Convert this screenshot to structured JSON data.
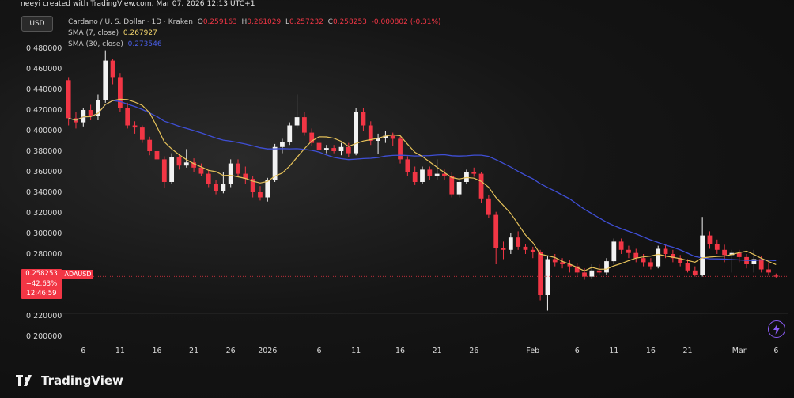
{
  "header": {
    "created_line": "neeyi created with TradingView.com, Mar 07, 2026 12:13 UTC+1",
    "currency": "USD",
    "symbol_line": "Cardano / U. S. Dollar · 1D · Kraken",
    "ohlc": {
      "O": "0.259163",
      "H": "0.261029",
      "L": "0.257232",
      "C": "0.258253",
      "change": "-0.000802 (-0.31%)"
    },
    "sma7_label": "SMA (7, close)",
    "sma7_value": "0.267927",
    "sma30_label": "SMA (30, close)",
    "sma30_value": "0.273546"
  },
  "price_badge": {
    "price": "0.258253",
    "change": "−42.63%",
    "countdown": "12:46:59",
    "symbol": "ADAUSD"
  },
  "brand": "TradingView",
  "colors": {
    "up": "#f2f2f2",
    "down": "#f23645",
    "sma7": "#e6c25a",
    "sma30": "#3f4fd6",
    "price_line": "#f23645"
  },
  "chart_data": {
    "type": "candlestick",
    "title": "",
    "xlabel": "",
    "ylabel": "",
    "ylim": [
      0.18,
      0.48
    ],
    "y_ticks": [
      "0.480000",
      "0.460000",
      "0.440000",
      "0.420000",
      "0.400000",
      "0.380000",
      "0.360000",
      "0.340000",
      "0.320000",
      "0.300000",
      "0.280000",
      "0.220000",
      "0.200000"
    ],
    "x_ticks": [
      "6",
      "11",
      "16",
      "21",
      "26",
      "2026",
      "6",
      "11",
      "16",
      "21",
      "26",
      "Feb",
      "6",
      "11",
      "16",
      "21",
      "Mar",
      "6"
    ],
    "candles": [
      {
        "o": 0.449,
        "h": 0.452,
        "l": 0.405,
        "c": 0.412
      },
      {
        "o": 0.412,
        "h": 0.418,
        "l": 0.402,
        "c": 0.408
      },
      {
        "o": 0.408,
        "h": 0.422,
        "l": 0.404,
        "c": 0.42
      },
      {
        "o": 0.42,
        "h": 0.425,
        "l": 0.41,
        "c": 0.414
      },
      {
        "o": 0.414,
        "h": 0.435,
        "l": 0.41,
        "c": 0.43
      },
      {
        "o": 0.43,
        "h": 0.478,
        "l": 0.427,
        "c": 0.468
      },
      {
        "o": 0.468,
        "h": 0.47,
        "l": 0.445,
        "c": 0.452
      },
      {
        "o": 0.452,
        "h": 0.456,
        "l": 0.418,
        "c": 0.422
      },
      {
        "o": 0.422,
        "h": 0.427,
        "l": 0.402,
        "c": 0.405
      },
      {
        "o": 0.405,
        "h": 0.409,
        "l": 0.397,
        "c": 0.403
      },
      {
        "o": 0.403,
        "h": 0.405,
        "l": 0.388,
        "c": 0.391
      },
      {
        "o": 0.391,
        "h": 0.394,
        "l": 0.376,
        "c": 0.38
      },
      {
        "o": 0.38,
        "h": 0.384,
        "l": 0.368,
        "c": 0.372
      },
      {
        "o": 0.372,
        "h": 0.375,
        "l": 0.344,
        "c": 0.35
      },
      {
        "o": 0.35,
        "h": 0.378,
        "l": 0.348,
        "c": 0.374
      },
      {
        "o": 0.374,
        "h": 0.377,
        "l": 0.362,
        "c": 0.366
      },
      {
        "o": 0.366,
        "h": 0.382,
        "l": 0.364,
        "c": 0.369
      },
      {
        "o": 0.369,
        "h": 0.373,
        "l": 0.36,
        "c": 0.364
      },
      {
        "o": 0.364,
        "h": 0.368,
        "l": 0.356,
        "c": 0.358
      },
      {
        "o": 0.358,
        "h": 0.361,
        "l": 0.345,
        "c": 0.348
      },
      {
        "o": 0.348,
        "h": 0.352,
        "l": 0.338,
        "c": 0.341
      },
      {
        "o": 0.341,
        "h": 0.36,
        "l": 0.339,
        "c": 0.348
      },
      {
        "o": 0.348,
        "h": 0.372,
        "l": 0.345,
        "c": 0.368
      },
      {
        "o": 0.368,
        "h": 0.372,
        "l": 0.356,
        "c": 0.358
      },
      {
        "o": 0.358,
        "h": 0.365,
        "l": 0.348,
        "c": 0.353
      },
      {
        "o": 0.353,
        "h": 0.356,
        "l": 0.335,
        "c": 0.34
      },
      {
        "o": 0.34,
        "h": 0.346,
        "l": 0.332,
        "c": 0.335
      },
      {
        "o": 0.335,
        "h": 0.354,
        "l": 0.331,
        "c": 0.352
      },
      {
        "o": 0.352,
        "h": 0.387,
        "l": 0.35,
        "c": 0.384
      },
      {
        "o": 0.384,
        "h": 0.392,
        "l": 0.378,
        "c": 0.389
      },
      {
        "o": 0.389,
        "h": 0.408,
        "l": 0.386,
        "c": 0.405
      },
      {
        "o": 0.405,
        "h": 0.435,
        "l": 0.402,
        "c": 0.413
      },
      {
        "o": 0.413,
        "h": 0.418,
        "l": 0.395,
        "c": 0.398
      },
      {
        "o": 0.398,
        "h": 0.402,
        "l": 0.385,
        "c": 0.388
      },
      {
        "o": 0.388,
        "h": 0.391,
        "l": 0.378,
        "c": 0.381
      },
      {
        "o": 0.381,
        "h": 0.386,
        "l": 0.378,
        "c": 0.383
      },
      {
        "o": 0.383,
        "h": 0.386,
        "l": 0.378,
        "c": 0.38
      },
      {
        "o": 0.38,
        "h": 0.388,
        "l": 0.376,
        "c": 0.384
      },
      {
        "o": 0.384,
        "h": 0.388,
        "l": 0.374,
        "c": 0.378
      },
      {
        "o": 0.378,
        "h": 0.422,
        "l": 0.376,
        "c": 0.418
      },
      {
        "o": 0.418,
        "h": 0.422,
        "l": 0.4,
        "c": 0.405
      },
      {
        "o": 0.405,
        "h": 0.409,
        "l": 0.386,
        "c": 0.39
      },
      {
        "o": 0.39,
        "h": 0.397,
        "l": 0.377,
        "c": 0.393
      },
      {
        "o": 0.393,
        "h": 0.4,
        "l": 0.388,
        "c": 0.395
      },
      {
        "o": 0.395,
        "h": 0.398,
        "l": 0.385,
        "c": 0.392
      },
      {
        "o": 0.392,
        "h": 0.394,
        "l": 0.368,
        "c": 0.372
      },
      {
        "o": 0.372,
        "h": 0.375,
        "l": 0.356,
        "c": 0.36
      },
      {
        "o": 0.36,
        "h": 0.365,
        "l": 0.347,
        "c": 0.35
      },
      {
        "o": 0.35,
        "h": 0.365,
        "l": 0.348,
        "c": 0.362
      },
      {
        "o": 0.362,
        "h": 0.365,
        "l": 0.352,
        "c": 0.356
      },
      {
        "o": 0.356,
        "h": 0.372,
        "l": 0.352,
        "c": 0.358
      },
      {
        "o": 0.358,
        "h": 0.362,
        "l": 0.352,
        "c": 0.356
      },
      {
        "o": 0.356,
        "h": 0.36,
        "l": 0.335,
        "c": 0.338
      },
      {
        "o": 0.338,
        "h": 0.352,
        "l": 0.335,
        "c": 0.35
      },
      {
        "o": 0.35,
        "h": 0.362,
        "l": 0.348,
        "c": 0.36
      },
      {
        "o": 0.36,
        "h": 0.364,
        "l": 0.355,
        "c": 0.358
      },
      {
        "o": 0.358,
        "h": 0.36,
        "l": 0.33,
        "c": 0.334
      },
      {
        "o": 0.334,
        "h": 0.337,
        "l": 0.315,
        "c": 0.318
      },
      {
        "o": 0.318,
        "h": 0.321,
        "l": 0.27,
        "c": 0.286
      },
      {
        "o": 0.286,
        "h": 0.292,
        "l": 0.275,
        "c": 0.284
      },
      {
        "o": 0.284,
        "h": 0.3,
        "l": 0.28,
        "c": 0.296
      },
      {
        "o": 0.296,
        "h": 0.302,
        "l": 0.284,
        "c": 0.287
      },
      {
        "o": 0.287,
        "h": 0.29,
        "l": 0.28,
        "c": 0.284
      },
      {
        "o": 0.284,
        "h": 0.287,
        "l": 0.276,
        "c": 0.282
      },
      {
        "o": 0.282,
        "h": 0.284,
        "l": 0.235,
        "c": 0.24
      },
      {
        "o": 0.24,
        "h": 0.278,
        "l": 0.225,
        "c": 0.275
      },
      {
        "o": 0.275,
        "h": 0.28,
        "l": 0.268,
        "c": 0.272
      },
      {
        "o": 0.272,
        "h": 0.276,
        "l": 0.266,
        "c": 0.27
      },
      {
        "o": 0.27,
        "h": 0.274,
        "l": 0.262,
        "c": 0.268
      },
      {
        "o": 0.268,
        "h": 0.271,
        "l": 0.258,
        "c": 0.262
      },
      {
        "o": 0.262,
        "h": 0.266,
        "l": 0.255,
        "c": 0.258
      },
      {
        "o": 0.258,
        "h": 0.27,
        "l": 0.256,
        "c": 0.264
      },
      {
        "o": 0.264,
        "h": 0.27,
        "l": 0.26,
        "c": 0.262
      },
      {
        "o": 0.262,
        "h": 0.276,
        "l": 0.26,
        "c": 0.273
      },
      {
        "o": 0.273,
        "h": 0.295,
        "l": 0.27,
        "c": 0.292
      },
      {
        "o": 0.292,
        "h": 0.295,
        "l": 0.28,
        "c": 0.284
      },
      {
        "o": 0.284,
        "h": 0.288,
        "l": 0.276,
        "c": 0.281
      },
      {
        "o": 0.281,
        "h": 0.285,
        "l": 0.272,
        "c": 0.276
      },
      {
        "o": 0.276,
        "h": 0.28,
        "l": 0.268,
        "c": 0.272
      },
      {
        "o": 0.272,
        "h": 0.276,
        "l": 0.265,
        "c": 0.268
      },
      {
        "o": 0.268,
        "h": 0.288,
        "l": 0.266,
        "c": 0.285
      },
      {
        "o": 0.285,
        "h": 0.289,
        "l": 0.276,
        "c": 0.28
      },
      {
        "o": 0.28,
        "h": 0.284,
        "l": 0.272,
        "c": 0.276
      },
      {
        "o": 0.276,
        "h": 0.279,
        "l": 0.268,
        "c": 0.271
      },
      {
        "o": 0.271,
        "h": 0.275,
        "l": 0.262,
        "c": 0.264
      },
      {
        "o": 0.264,
        "h": 0.268,
        "l": 0.258,
        "c": 0.26
      },
      {
        "o": 0.26,
        "h": 0.316,
        "l": 0.258,
        "c": 0.298
      },
      {
        "o": 0.298,
        "h": 0.302,
        "l": 0.285,
        "c": 0.29
      },
      {
        "o": 0.29,
        "h": 0.294,
        "l": 0.28,
        "c": 0.284
      },
      {
        "o": 0.284,
        "h": 0.289,
        "l": 0.272,
        "c": 0.279
      },
      {
        "o": 0.279,
        "h": 0.284,
        "l": 0.262,
        "c": 0.281
      },
      {
        "o": 0.281,
        "h": 0.284,
        "l": 0.272,
        "c": 0.277
      },
      {
        "o": 0.277,
        "h": 0.28,
        "l": 0.266,
        "c": 0.27
      },
      {
        "o": 0.27,
        "h": 0.284,
        "l": 0.262,
        "c": 0.275
      },
      {
        "o": 0.275,
        "h": 0.278,
        "l": 0.262,
        "c": 0.265
      },
      {
        "o": 0.265,
        "h": 0.272,
        "l": 0.259,
        "c": 0.262
      },
      {
        "o": 0.259,
        "h": 0.261,
        "l": 0.257,
        "c": 0.258
      }
    ],
    "series": [
      {
        "name": "SMA (7, close)",
        "color": "#e6c25a"
      },
      {
        "name": "SMA (30, close)",
        "color": "#3f4fd6"
      }
    ],
    "last_price": 0.258253
  }
}
